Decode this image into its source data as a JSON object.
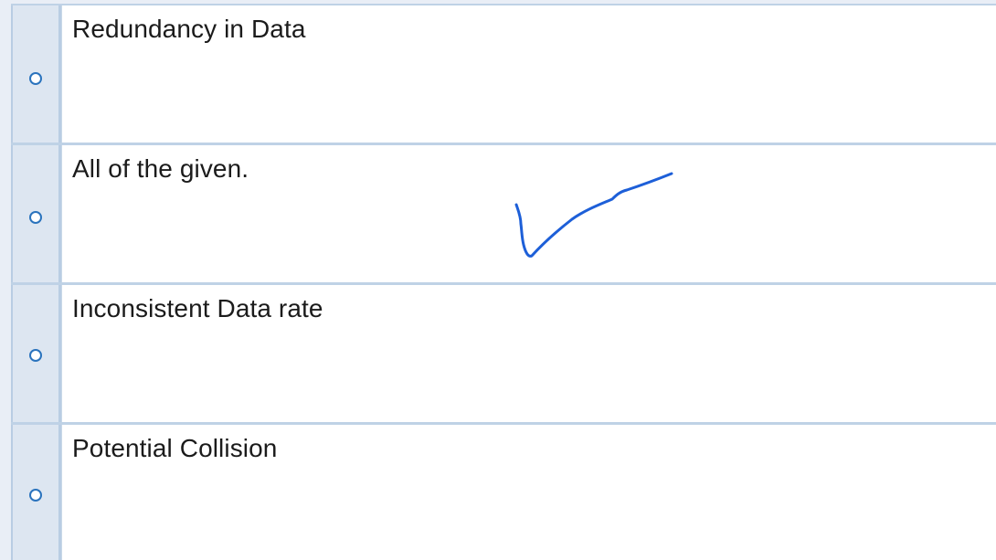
{
  "options": [
    {
      "label": "Redundancy in Data"
    },
    {
      "label": "All of the given."
    },
    {
      "label": "Inconsistent Data rate"
    },
    {
      "label": "Potential Collision"
    }
  ],
  "annotation": {
    "icon": "handwritten-checkmark-icon",
    "color": "#1d5fd8"
  },
  "colors": {
    "radio_border": "#2a73bd",
    "radio_cell_bg": "#dde6f1",
    "row_border": "#bfd2e6",
    "page_bg": "#e9eef6"
  }
}
